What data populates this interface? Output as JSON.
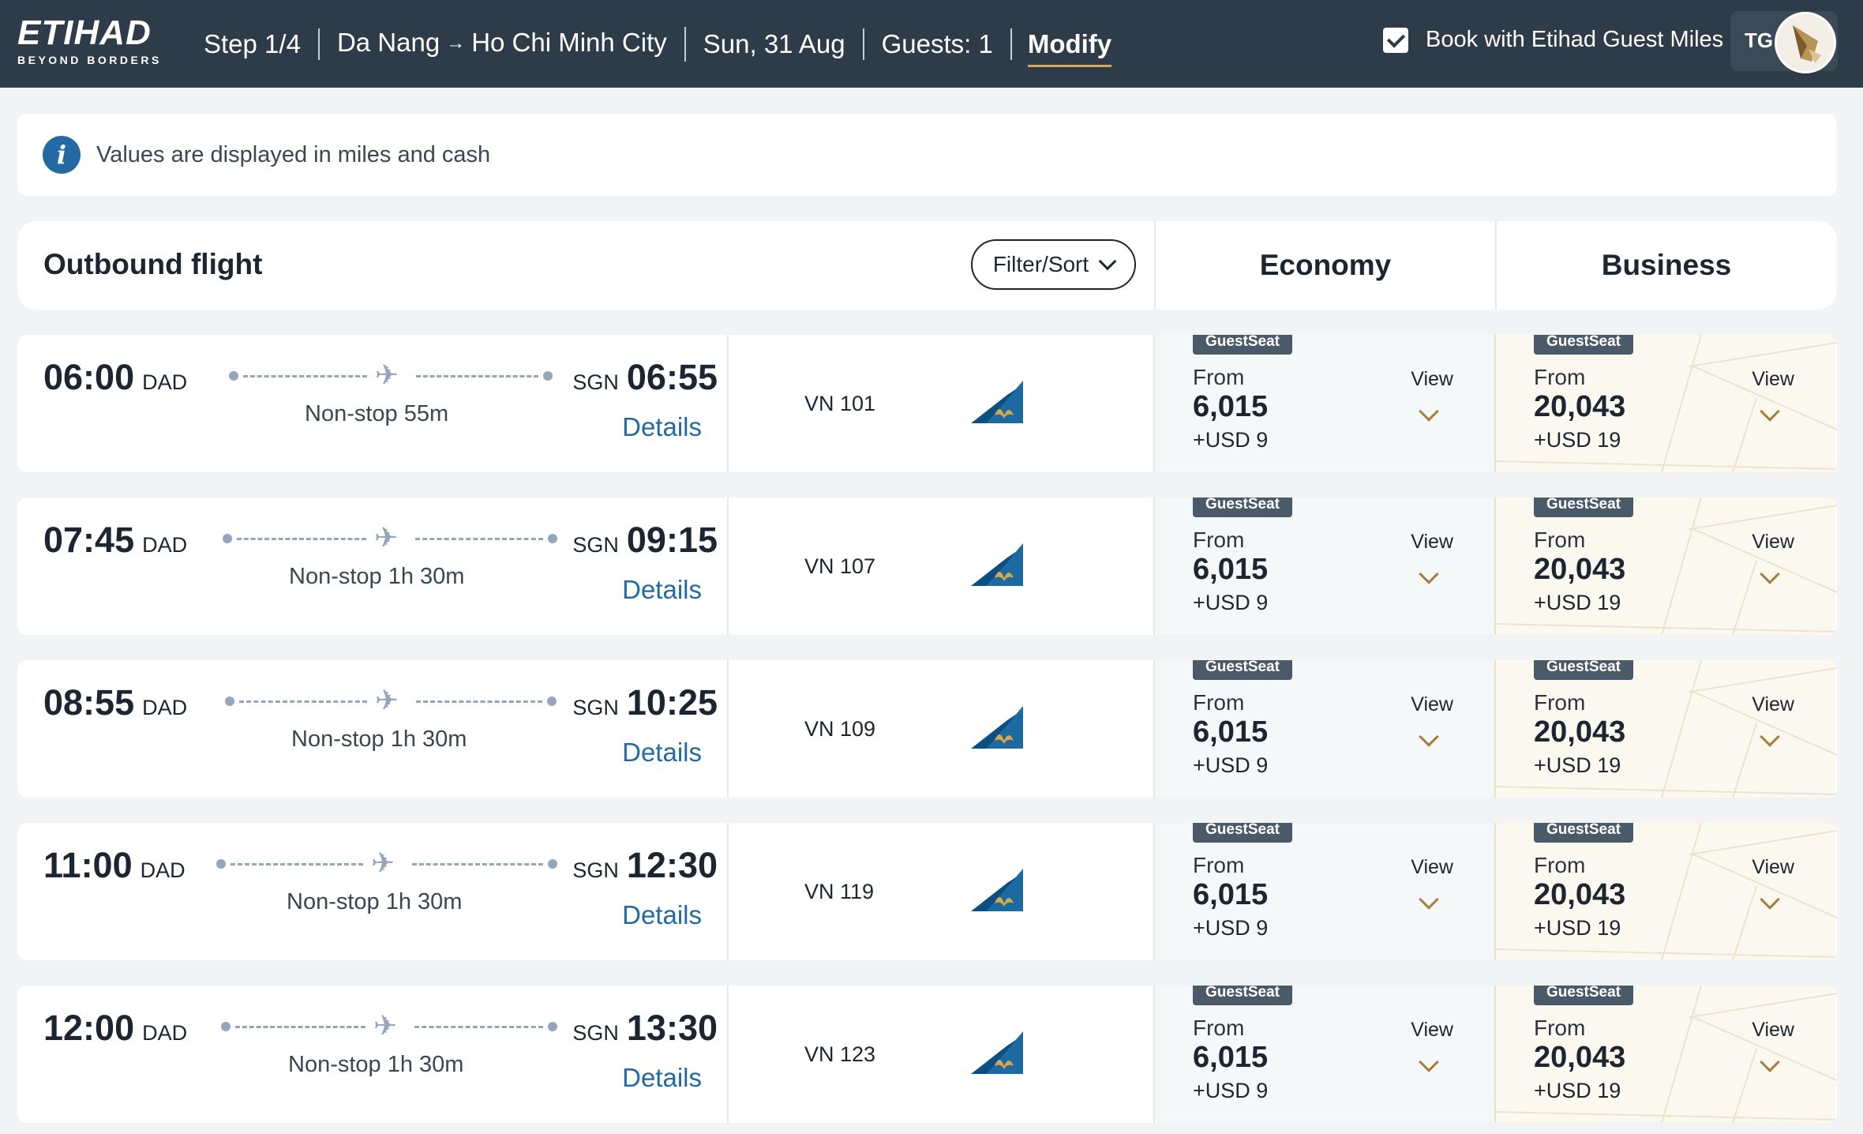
{
  "header": {
    "logo_text": "ETIHAD",
    "logo_sub": "BEYOND BORDERS",
    "step": "Step 1/4",
    "origin": "Da Nang",
    "destination": "Ho Chi Minh City",
    "date": "Sun, 31 Aug",
    "guests": "Guests: 1",
    "modify_label": "Modify",
    "miles_toggle_label": "Book with Etihad Guest Miles",
    "miles_toggle_checked": true,
    "user_initials": "TG"
  },
  "banner": {
    "text": "Values are displayed in miles and cash",
    "icon": "info-icon"
  },
  "table": {
    "title": "Outbound flight",
    "filter_label": "Filter/Sort",
    "cabins": [
      "Economy",
      "Business"
    ]
  },
  "flights": [
    {
      "dep_time": "06:00",
      "dep_code": "DAD",
      "arr_time": "06:55",
      "arr_code": "SGN",
      "duration": "Non-stop 55m",
      "details": "Details",
      "flight_no": "VN 101",
      "economy": {
        "badge": "GuestSeat",
        "from": "From",
        "miles": "6,015",
        "cash": "+USD 9",
        "view": "View"
      },
      "business": {
        "badge": "GuestSeat",
        "from": "From",
        "miles": "20,043",
        "cash": "+USD 19",
        "view": "View"
      }
    },
    {
      "dep_time": "07:45",
      "dep_code": "DAD",
      "arr_time": "09:15",
      "arr_code": "SGN",
      "duration": "Non-stop 1h 30m",
      "details": "Details",
      "flight_no": "VN 107",
      "economy": {
        "badge": "GuestSeat",
        "from": "From",
        "miles": "6,015",
        "cash": "+USD 9",
        "view": "View"
      },
      "business": {
        "badge": "GuestSeat",
        "from": "From",
        "miles": "20,043",
        "cash": "+USD 19",
        "view": "View"
      }
    },
    {
      "dep_time": "08:55",
      "dep_code": "DAD",
      "arr_time": "10:25",
      "arr_code": "SGN",
      "duration": "Non-stop 1h 30m",
      "details": "Details",
      "flight_no": "VN 109",
      "economy": {
        "badge": "GuestSeat",
        "from": "From",
        "miles": "6,015",
        "cash": "+USD 9",
        "view": "View"
      },
      "business": {
        "badge": "GuestSeat",
        "from": "From",
        "miles": "20,043",
        "cash": "+USD 19",
        "view": "View"
      }
    },
    {
      "dep_time": "11:00",
      "dep_code": "DAD",
      "arr_time": "12:30",
      "arr_code": "SGN",
      "duration": "Non-stop 1h 30m",
      "details": "Details",
      "flight_no": "VN 119",
      "economy": {
        "badge": "GuestSeat",
        "from": "From",
        "miles": "6,015",
        "cash": "+USD 9",
        "view": "View"
      },
      "business": {
        "badge": "GuestSeat",
        "from": "From",
        "miles": "20,043",
        "cash": "+USD 19",
        "view": "View"
      }
    },
    {
      "dep_time": "12:00",
      "dep_code": "DAD",
      "arr_time": "13:30",
      "arr_code": "SGN",
      "duration": "Non-stop 1h 30m",
      "details": "Details",
      "flight_no": "VN 123",
      "economy": {
        "badge": "GuestSeat",
        "from": "From",
        "miles": "6,015",
        "cash": "+USD 9",
        "view": "View"
      },
      "business": {
        "badge": "GuestSeat",
        "from": "From",
        "miles": "20,043",
        "cash": "+USD 19",
        "view": "View"
      }
    }
  ],
  "colors": {
    "header_bg": "#2e3b48",
    "link": "#236aa5",
    "badge_bg": "#4b5a68",
    "business_bg": "#fbf8ef",
    "economy_bg": "#f4f8f9",
    "accent_gold": "#cfa767"
  }
}
